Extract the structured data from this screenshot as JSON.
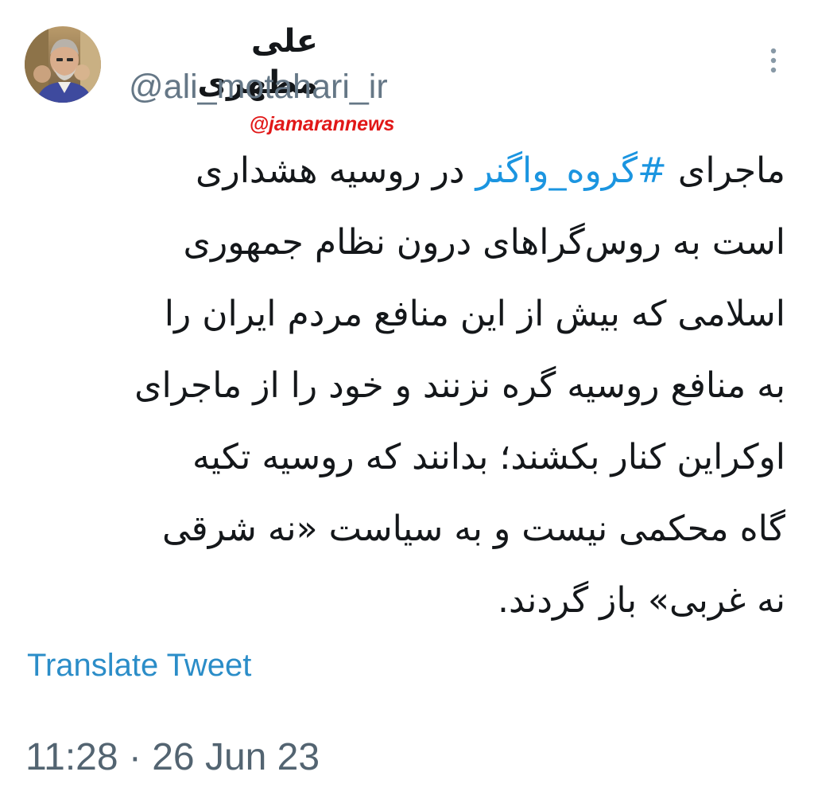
{
  "author": {
    "display_name": "علی مطهری",
    "handle": "@ali_motahari_ir",
    "avatar_icon": "user-photo-avatar"
  },
  "menu": {
    "more_icon": "vertical-ellipsis-icon"
  },
  "watermark": {
    "text": "@jamarannews",
    "color": "#e11717"
  },
  "tweet": {
    "lines": [
      {
        "before": "ماجرای ",
        "hashtag": "#گروه_واگنر",
        "after": " در روسیه هشداری"
      },
      {
        "text": "است به روس‌گراهای درون نظام جمهوری"
      },
      {
        "text": "اسلامی که بیش از این منافع مردم ایران را"
      },
      {
        "text": "به منافع روسیه گره نزنند و خود را از ماجرای"
      },
      {
        "text": "اوکراین کنار بکشند؛ بدانند که روسیه تکیه"
      },
      {
        "text": "گاه محکمی نیست و به سیاست «نه شرقی"
      },
      {
        "text": "نه غربی» باز گردند."
      }
    ],
    "hashtag_color": "#1b95e0"
  },
  "translate_label": "Translate Tweet",
  "timestamp": "11:28 · 26 Jun 23"
}
